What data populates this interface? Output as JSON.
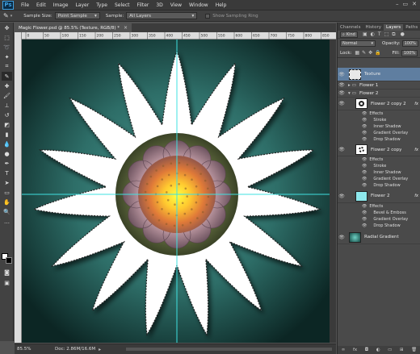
{
  "app": {
    "logo": "Ps"
  },
  "menu": [
    "File",
    "Edit",
    "Image",
    "Layer",
    "Type",
    "Select",
    "Filter",
    "3D",
    "View",
    "Window",
    "Help"
  ],
  "window_controls": [
    "–",
    "▭",
    "✕"
  ],
  "options": {
    "sample_size_label": "Sample Size:",
    "sample_size_value": "Point Sample",
    "sample_label": "Sample:",
    "sample_value": "All Layers",
    "show_ring_label": "Show Sampling Ring"
  },
  "document": {
    "tab_title": "Magic Flower.psd @ 85.5% (Texture, RGB/8) *",
    "close": "×",
    "zoom": "85.5%",
    "doc_info": "Doc: 2.86M/16.6M"
  },
  "ruler_ticks": [
    "0",
    "50",
    "100",
    "150",
    "200",
    "250",
    "300",
    "350",
    "400",
    "450",
    "500",
    "550",
    "600",
    "650",
    "700",
    "750",
    "800",
    "850"
  ],
  "panels": {
    "tabs": [
      "Channels",
      "History",
      "Layers",
      "Paths"
    ],
    "active_tab": "Layers",
    "filter_kind": "Kind",
    "blend_mode": "Normal",
    "opacity_label": "Opacity:",
    "opacity_value": "100%",
    "lock_label": "Lock:",
    "fill_label": "Fill:",
    "fill_value": "100%"
  },
  "layers": [
    {
      "name": "Texture",
      "type": "layer"
    },
    {
      "name": "Flower 1",
      "type": "group"
    },
    {
      "name": "Flower 2",
      "type": "group"
    },
    {
      "name": "Flower 2 copy 2",
      "type": "layer",
      "fx": "fx",
      "effects_label": "Effects",
      "effects": [
        "Stroke",
        "Inner Shadow",
        "Gradient Overlay",
        "Drop Shadow"
      ]
    },
    {
      "name": "Flower 2 copy",
      "type": "layer",
      "fx": "fx",
      "effects_label": "Effects",
      "effects": [
        "Stroke",
        "Inner Shadow",
        "Gradient Overlay",
        "Drop Shadow"
      ]
    },
    {
      "name": "Flower 2",
      "type": "layer",
      "fx": "fx",
      "effects_label": "Effects",
      "effects": [
        "Bevel & Emboss",
        "Gradient Overlay",
        "Drop Shadow"
      ]
    },
    {
      "name": "Radial Gradient",
      "type": "layer"
    }
  ],
  "panel_footer_icons": [
    "link-icon",
    "fx-icon",
    "mask-icon",
    "adjustment-icon",
    "folder-icon",
    "new-layer-icon",
    "trash-icon"
  ],
  "colors": {
    "canvas_bg_center": "#4a9c94",
    "canvas_bg_edge": "#0c2624",
    "guide": "#3fe0e0",
    "petal": "#ffffff",
    "ring": "#5d6a3f",
    "flower_center": "#ffea2a"
  }
}
